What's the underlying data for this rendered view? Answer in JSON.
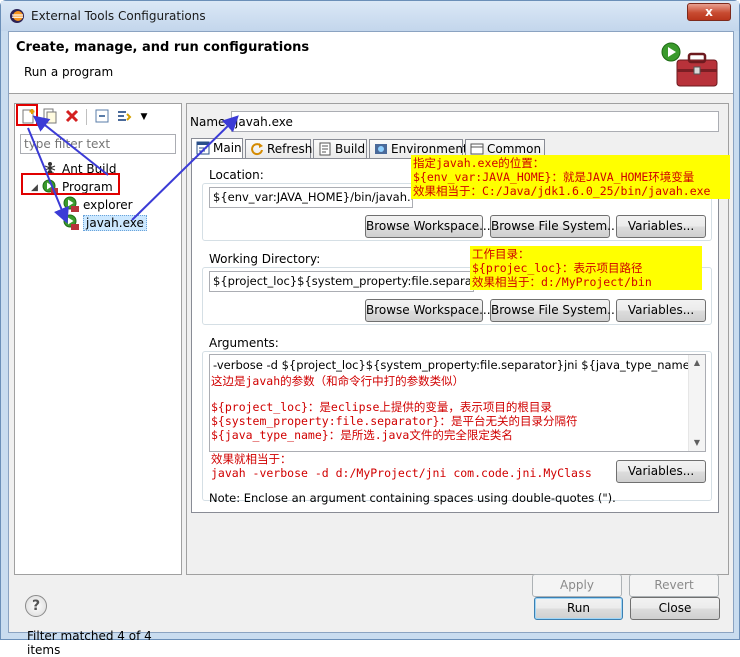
{
  "window": {
    "title": "External Tools Configurations",
    "close_symbol": "x"
  },
  "header": {
    "title": "Create, manage, and run configurations",
    "subtitle": "Run a program"
  },
  "left": {
    "filter_placeholder": "type filter text",
    "tree": [
      {
        "label": "Ant Build",
        "icon": "ant-build-icon"
      },
      {
        "label": "Program",
        "icon": "program-icon",
        "expanded": true
      },
      {
        "label": "explorer",
        "icon": "program-launch-icon"
      },
      {
        "label": "javah.exe",
        "icon": "program-launch-icon",
        "selected": true
      }
    ],
    "filter_status": "Filter matched 4 of 4 items"
  },
  "config": {
    "name_label": "Name:",
    "name_value": "javah.exe",
    "tabs": [
      {
        "label": "Main",
        "icon": "main-tab-icon",
        "active": true
      },
      {
        "label": "Refresh",
        "icon": "refresh-icon"
      },
      {
        "label": "Build",
        "icon": "build-icon"
      },
      {
        "label": "Environment",
        "icon": "environment-icon"
      },
      {
        "label": "Common",
        "icon": "common-icon"
      }
    ],
    "location": {
      "label": "Location:",
      "value": "${env_var:JAVA_HOME}/bin/javah.exe",
      "browse_workspace": "Browse Workspace...",
      "browse_fs": "Browse File System...",
      "variables": "Variables..."
    },
    "working_dir": {
      "label": "Working Directory:",
      "value": "${project_loc}${system_property:file.separator}bin",
      "browse_workspace": "Browse Workspace...",
      "browse_fs": "Browse File System...",
      "variables": "Variables..."
    },
    "arguments": {
      "label": "Arguments:",
      "value": "-verbose -d ${project_loc}${system_property:file.separator}jni ${java_type_name}",
      "variables": "Variables...",
      "note": "Note: Enclose an argument containing spaces using double-quotes (\")."
    },
    "apply": "Apply",
    "revert": "Revert"
  },
  "footer": {
    "run": "Run",
    "close": "Close",
    "help_symbol": "?"
  },
  "annotations": {
    "location": [
      "指定javah.exe的位置：",
      "${env_var:JAVA_HOME}：就是JAVA_HOME环境变量",
      "效果相当于：C:/Java/jdk1.6.0_25/bin/javah.exe"
    ],
    "working_dir": [
      "工作目录：",
      "${projec_loc}：表示项目路径",
      "效果相当于：d:/MyProject/bin"
    ],
    "args_intro": "这边是javah的参数（和命令行中打的参数类似）",
    "args_vars": [
      "${project_loc}：是eclipse上提供的变量，表示项目的根目录",
      "${system_property:file.separator}：是平台无关的目录分隔符",
      "${java_type_name}：是所选.java文件的完全限定类名"
    ],
    "args_effect": [
      "效果就相当于：",
      "javah -verbose -d d:/MyProject/jni com.code.jni.MyClass"
    ]
  },
  "colors": {
    "annotation_bg": "#ffff00",
    "annotation_text": "#d00000",
    "arrow": "#3b3bd6",
    "highlight_box": "#e00000"
  }
}
